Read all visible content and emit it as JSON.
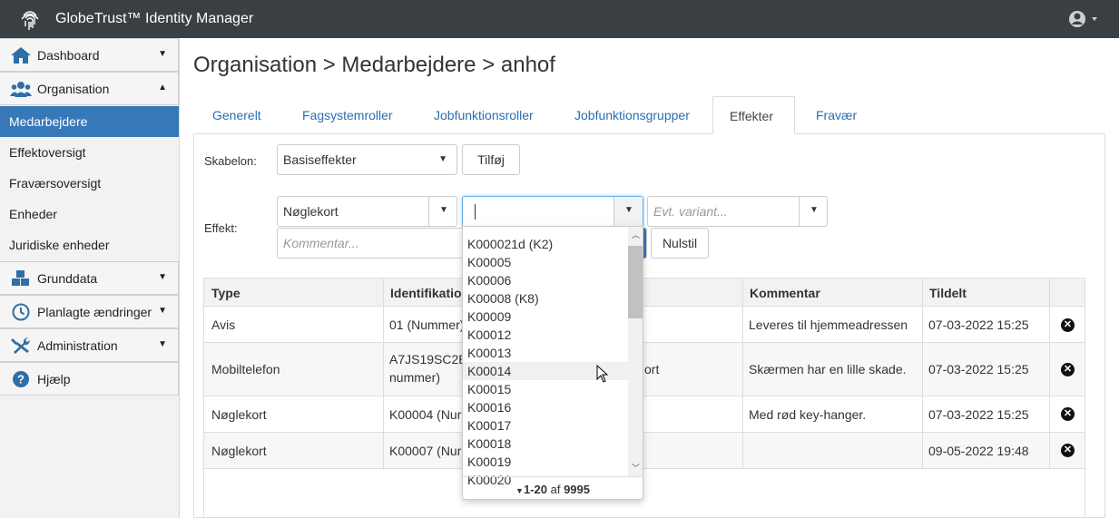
{
  "app": {
    "title": "GlobeTrust™ Identity Manager"
  },
  "sidebar": {
    "items": [
      {
        "label": "Dashboard",
        "icon": "home-icon",
        "caret": "▼"
      },
      {
        "label": "Organisation",
        "icon": "users-icon",
        "caret": "▲"
      },
      {
        "label": "Grunddata",
        "icon": "cubes-icon",
        "caret": "▼"
      },
      {
        "label": "Planlagte ændringer",
        "icon": "clock-icon",
        "caret": "▼"
      },
      {
        "label": "Administration",
        "icon": "tools-icon",
        "caret": "▼"
      },
      {
        "label": "Hjælp",
        "icon": "help-icon"
      }
    ],
    "subitems": [
      {
        "label": "Medarbejdere",
        "active": true
      },
      {
        "label": "Effektoversigt"
      },
      {
        "label": "Fraværsoversigt"
      },
      {
        "label": "Enheder"
      },
      {
        "label": "Juridiske enheder"
      }
    ]
  },
  "page": {
    "title": "Organisation > Medarbejdere > anhof"
  },
  "tabs": [
    "Generelt",
    "Fagsystemroller",
    "Jobfunktionsroller",
    "Jobfunktionsgrupper",
    "Effekter",
    "Fravær"
  ],
  "form": {
    "skabelon_label": "Skabelon:",
    "skabelon_value": "Basiseffekter",
    "add_button": "Tilføj",
    "effekt_label": "Effekt:",
    "effekt_value": "Nøglekort",
    "id_value": "",
    "variant_placeholder": "Evt. variant...",
    "comment_placeholder": "Kommentar...",
    "reset_button": "Nulstil"
  },
  "table": {
    "headers": [
      "Type",
      "Identifikatio",
      "",
      "Kommentar",
      "Tildelt",
      ""
    ],
    "rows": [
      {
        "type": "Avis",
        "id": "01 (Nummer)",
        "id2": "",
        "mid": "",
        "comment": "Leveres til hjemmeadressen",
        "assigned": "07-03-2022 15:25"
      },
      {
        "type": "Mobiltelefon",
        "id": "A7JS19SC2E",
        "id2": "nummer)",
        "mid": "ort",
        "comment": "Skærmen har en lille skade.",
        "assigned": "07-03-2022 15:25"
      },
      {
        "type": "Nøglekort",
        "id": "K00004 (Nur",
        "id2": "",
        "mid": "",
        "comment": "Med rød key-hanger.",
        "assigned": "07-03-2022 15:25"
      },
      {
        "type": "Nøglekort",
        "id": "K00007 (Nur",
        "id2": "",
        "mid": "",
        "comment": "",
        "assigned": "09-05-2022 19:48"
      }
    ]
  },
  "dropdown": {
    "items": [
      "K000021d (K2)",
      "K00005",
      "K00006",
      "K00008 (K8)",
      "K00009",
      "K00012",
      "K00013",
      "K00014",
      "K00015",
      "K00016",
      "K00017",
      "K00018",
      "K00019",
      "K00020"
    ],
    "highlighted": "K00014",
    "range": "1-20",
    "of": "af",
    "total": "9995"
  }
}
